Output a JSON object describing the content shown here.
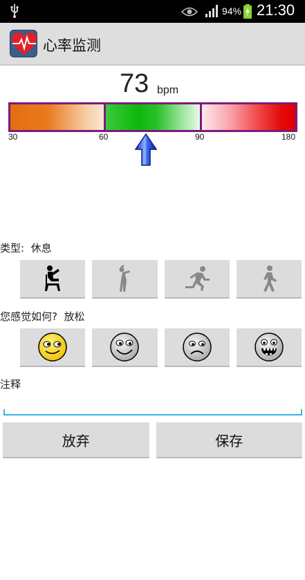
{
  "status_bar": {
    "battery": "94%",
    "time": "21:30"
  },
  "app": {
    "title": "心率监测"
  },
  "heart_rate": {
    "value": "73",
    "unit": "bpm",
    "gauge_ticks": [
      "30",
      "60",
      "90",
      "180"
    ],
    "zones": [
      {
        "from": 30,
        "to": 60,
        "color": "#e97a1f"
      },
      {
        "from": 60,
        "to": 90,
        "color": "#0cb80c"
      },
      {
        "from": 90,
        "to": 180,
        "color": "#e00000"
      }
    ],
    "pointer_value": 73
  },
  "activity": {
    "prompt": "类型:",
    "selected": "休息",
    "options": [
      {
        "icon": "sitting-person-icon",
        "selected": true
      },
      {
        "icon": "stretching-person-icon",
        "selected": false
      },
      {
        "icon": "running-person-icon",
        "selected": false
      },
      {
        "icon": "walking-person-icon",
        "selected": false
      }
    ]
  },
  "feeling": {
    "prompt": "您感觉如何?",
    "selected": "放松",
    "options": [
      {
        "icon": "relaxed-face-icon",
        "selected": true
      },
      {
        "icon": "happy-face-icon",
        "selected": false
      },
      {
        "icon": "sad-face-icon",
        "selected": false
      },
      {
        "icon": "excited-face-icon",
        "selected": false
      }
    ]
  },
  "note": {
    "label": "注释",
    "value": ""
  },
  "buttons": {
    "discard": "放弃",
    "save": "保存"
  }
}
